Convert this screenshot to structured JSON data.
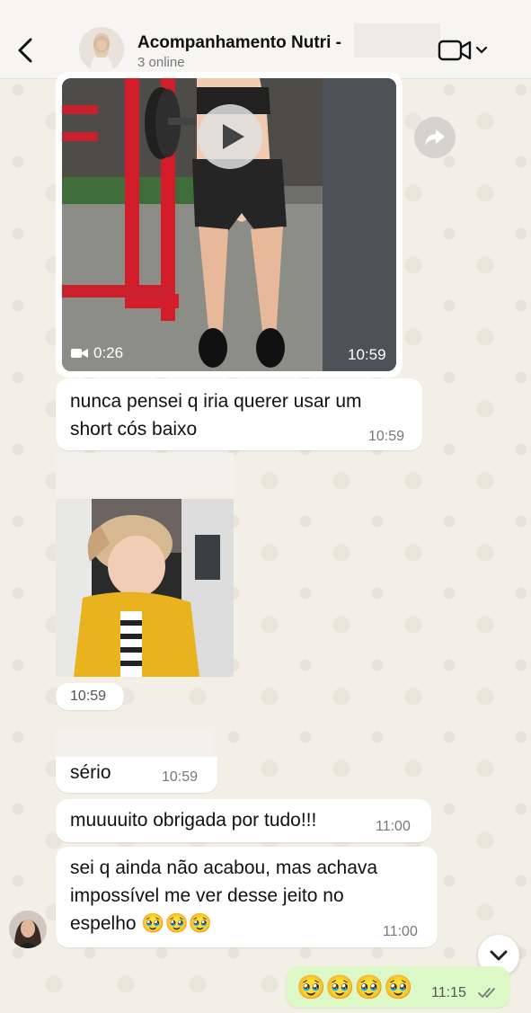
{
  "header": {
    "title": "Acompanhamento Nutri -",
    "subtitle": "3 online"
  },
  "messages": {
    "video": {
      "duration": "0:26",
      "time": "10:59"
    },
    "m1": {
      "text": "nunca pensei q iria querer usar um\nshort cós baixo",
      "time": "10:59"
    },
    "image": {
      "time": "10:59"
    },
    "m2": {
      "text": "sério",
      "time": "10:59"
    },
    "m3": {
      "text": "muuuuito obrigada por tudo!!!",
      "time": "11:00"
    },
    "m4": {
      "text": "sei q ainda não acabou, mas achava\nimpossível me ver desse jeito no\nespelho 🥹🥹🥹",
      "time": "11:00"
    },
    "m5": {
      "text": "🥹🥹🥹🥹",
      "time": "11:15"
    }
  },
  "colors": {
    "outgoing_bubble": "#dcf8c6",
    "incoming_bubble": "#ffffff",
    "wallpaper": "#f3eee6",
    "read_receipt": "#7a7a7a"
  },
  "icons": {
    "back": "chevron-left-icon",
    "video_call": "video-camera-icon",
    "dropdown": "chevron-down-icon",
    "play": "play-icon",
    "forward": "forward-arrow-icon",
    "scroll_down": "chevron-down-icon",
    "read": "double-check-icon"
  }
}
